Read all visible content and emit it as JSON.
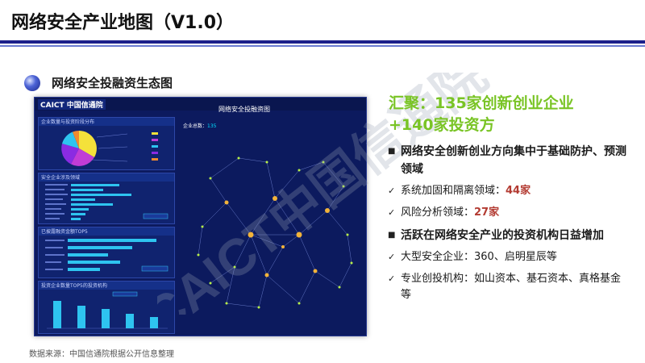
{
  "slide": {
    "title": "网络安全产业地图（V1.0）",
    "section": "网络安全投融资生态图"
  },
  "dashboard": {
    "logo_text": "CAICT 中国信通院",
    "title": "网络安全投融资图",
    "count_label": "企业总数：",
    "count_value": "135",
    "panels": [
      {
        "title": "企业数量与投资阶段分布"
      },
      {
        "title": "安全企业涉及领域"
      },
      {
        "title": "已披露融资金额TOP5"
      },
      {
        "title": "投资企业数量TOP5的投资机构"
      }
    ]
  },
  "summary": {
    "line1": "汇聚：135家创新创业企业",
    "line2": "+140家投资方"
  },
  "bullets": [
    {
      "type": "main",
      "text": "网络安全创新创业方向集中于基础防护、预测领域"
    },
    {
      "type": "sub",
      "text": "系统加固和隔离领域：",
      "num": "44家"
    },
    {
      "type": "sub",
      "text": "风险分析领域：",
      "num": "27家"
    },
    {
      "type": "main",
      "text": "活跃在网络安全产业的投资机构日益增加"
    },
    {
      "type": "sub",
      "text": "大型安全企业：360、启明星辰等"
    },
    {
      "type": "sub",
      "text": "专业创投机构：如山资本、基石资本、真格基金等"
    }
  ],
  "watermark": "CAICT中国信通院",
  "footer": "数据来源：中国信通院根据公开信息整理",
  "colors": {
    "dashboard_bg": "#0c1a5e",
    "accent_green": "#79c425",
    "number_red": "#b33b32",
    "rule_blue": "#1b1f8a"
  }
}
